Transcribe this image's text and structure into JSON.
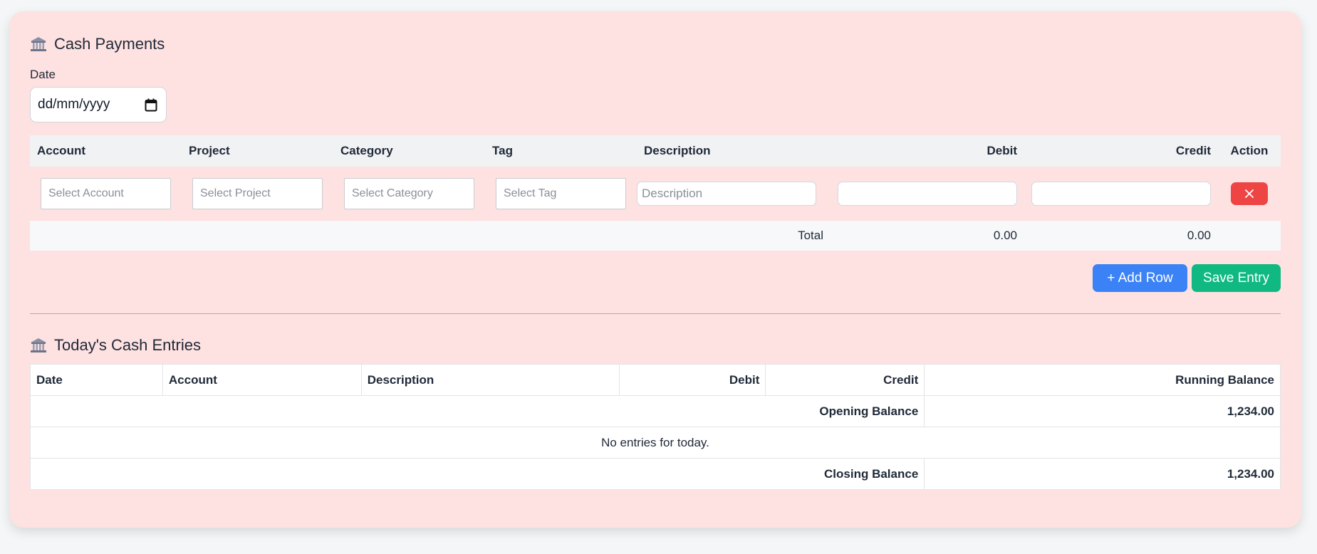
{
  "payments": {
    "title": "Cash Payments",
    "icon": "bank-icon",
    "date_label": "Date",
    "date_placeholder": "dd/mm/yyyy",
    "columns": {
      "account": "Account",
      "project": "Project",
      "category": "Category",
      "tag": "Tag",
      "description": "Description",
      "debit": "Debit",
      "credit": "Credit",
      "action": "Action"
    },
    "row": {
      "account_placeholder": "Select Account",
      "project_placeholder": "Select Project",
      "category_placeholder": "Select Category",
      "tag_placeholder": "Select Tag",
      "description_placeholder": "Description",
      "debit_value": "",
      "credit_value": ""
    },
    "total_label": "Total",
    "total_debit": "0.00",
    "total_credit": "0.00",
    "add_row_label": "+ Add Row",
    "save_label": "Save Entry"
  },
  "today": {
    "title": "Today's Cash Entries",
    "icon": "bank-icon",
    "columns": {
      "date": "Date",
      "account": "Account",
      "description": "Description",
      "debit": "Debit",
      "credit": "Credit",
      "running_balance": "Running Balance"
    },
    "opening_label": "Opening Balance",
    "opening_value": "1,234.00",
    "empty_message": "No entries for today.",
    "closing_label": "Closing Balance",
    "closing_value": "1,234.00"
  },
  "colors": {
    "card_bg": "#fee1e1",
    "add_button": "#3b82f6",
    "save_button": "#10b981",
    "delete_button": "#ef4444"
  }
}
